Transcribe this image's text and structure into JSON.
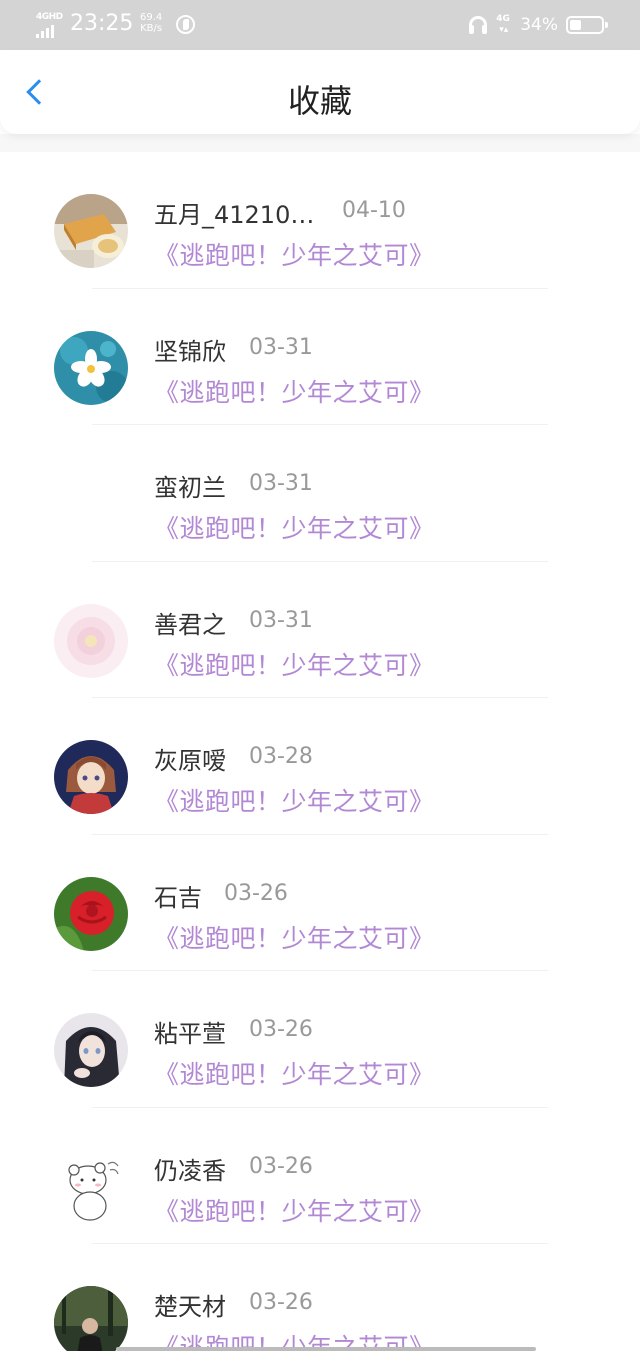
{
  "status_bar": {
    "network_type": "4GHD",
    "time": "23:25",
    "speed_value": "69.4",
    "speed_unit": "KB/s",
    "signal_2": "4G",
    "battery_level": "34%"
  },
  "nav": {
    "title": "收藏"
  },
  "items": [
    {
      "name": "五月_41210…",
      "date": "04-10",
      "tag": "《逃跑吧！少年之艾可》",
      "avatar": "cake-photo-icon"
    },
    {
      "name": "坚锦欣",
      "date": "03-31",
      "tag": "《逃跑吧！少年之艾可》",
      "avatar": "flower-on-water-icon"
    },
    {
      "name": "蛮初兰",
      "date": "03-31",
      "tag": "《逃跑吧！少年之艾可》",
      "avatar": "blank-avatar"
    },
    {
      "name": "善君之",
      "date": "03-31",
      "tag": "《逃跑吧！少年之艾可》",
      "avatar": "pink-flower-icon"
    },
    {
      "name": "灰原嗳",
      "date": "03-28",
      "tag": "《逃跑吧！少年之艾可》",
      "avatar": "anime-girl-icon"
    },
    {
      "name": "石吉",
      "date": "03-26",
      "tag": "《逃跑吧！少年之艾可》",
      "avatar": "red-rose-icon"
    },
    {
      "name": "粘平萱",
      "date": "03-26",
      "tag": "《逃跑吧！少年之艾可》",
      "avatar": "anime-portrait-icon"
    },
    {
      "name": "仍凌香",
      "date": "03-26",
      "tag": "《逃跑吧！少年之艾可》",
      "avatar": "cartoon-bear-icon"
    },
    {
      "name": "楚天材",
      "date": "03-26",
      "tag": "《逃跑吧！少年之艾可》",
      "avatar": "person-photo-icon"
    }
  ]
}
